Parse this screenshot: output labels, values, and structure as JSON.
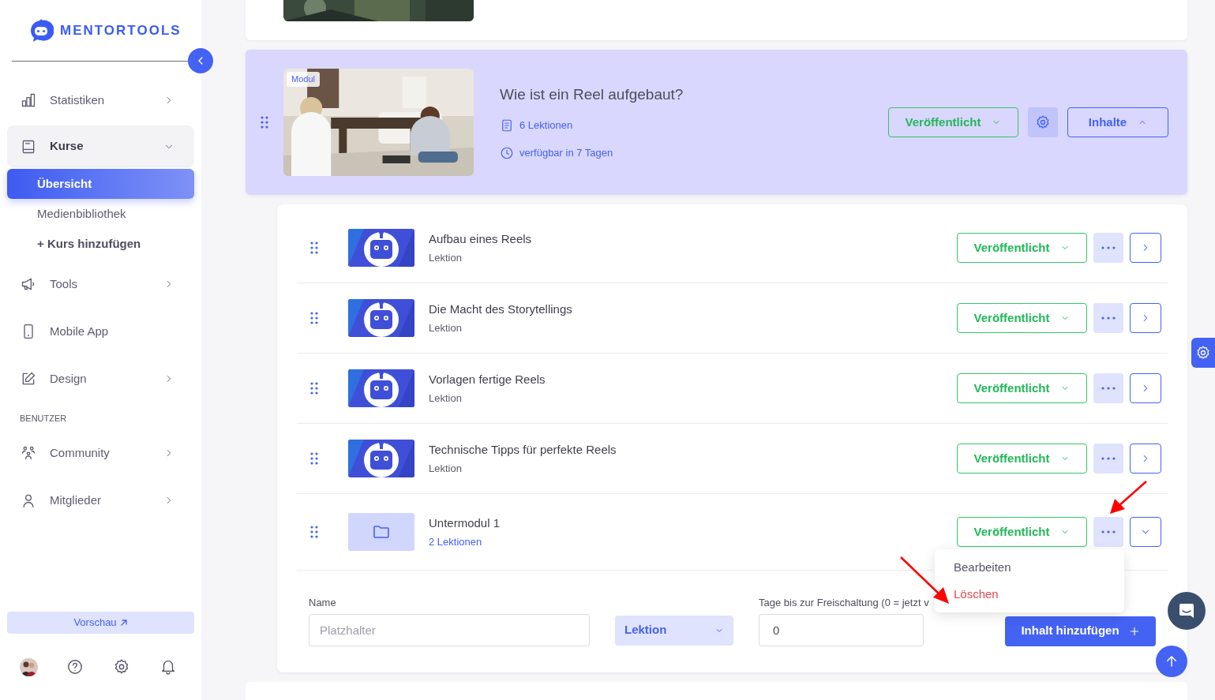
{
  "brand": "MENTORTOOLS",
  "sidebar": {
    "items": [
      {
        "kind": "item",
        "label": "Statistiken",
        "expanded": false
      },
      {
        "kind": "item",
        "label": "Kurse",
        "expanded": true,
        "children": [
          {
            "label": "Übersicht",
            "selected": true
          },
          {
            "label": "Medienbibliothek",
            "selected": false
          },
          {
            "label": "+ Kurs hinzufügen",
            "selected": false
          }
        ]
      },
      {
        "kind": "item",
        "label": "Tools",
        "expanded": false
      },
      {
        "kind": "item",
        "label": "Mobile App"
      },
      {
        "kind": "item",
        "label": "Design",
        "expanded": false
      },
      {
        "kind": "section",
        "label": "BENUTZER"
      },
      {
        "kind": "item",
        "label": "Community",
        "expanded": false
      },
      {
        "kind": "item",
        "label": "Mitglieder",
        "expanded": false
      }
    ],
    "preview_button": "Vorschau"
  },
  "module": {
    "badge": "Modul",
    "title": "Wie ist ein Reel aufgebaut?",
    "lessons": "6 Lektionen",
    "availability": "verfügbar in 7 Tagen",
    "status": "Veröffentlicht",
    "contents_button": "Inhalte",
    "expanded": true
  },
  "items": [
    {
      "kind": "lesson",
      "title": "Aufbau eines Reels",
      "subtitle": "Lektion",
      "status": "Veröffentlicht"
    },
    {
      "kind": "lesson",
      "title": "Die Macht des Storytellings",
      "subtitle": "Lektion",
      "status": "Veröffentlicht"
    },
    {
      "kind": "lesson",
      "title": "Vorlagen fertige Reels",
      "subtitle": "Lektion",
      "status": "Veröffentlicht"
    },
    {
      "kind": "lesson",
      "title": "Technische Tipps für perfekte Reels",
      "subtitle": "Lektion",
      "status": "Veröffentlicht"
    },
    {
      "kind": "submodule",
      "title": "Untermodul 1",
      "subtitle": "2 Lektionen",
      "status": "Veröffentlicht"
    }
  ],
  "context_menu": [
    {
      "kind": "normal",
      "label": "Bearbeiten"
    },
    {
      "kind": "danger",
      "label": "Löschen"
    }
  ],
  "form": {
    "name_label": "Name",
    "name_placeholder": "Platzhalter",
    "type_value": "Lektion",
    "days_label": "Tage bis zur Freischaltung (0 = jetzt v",
    "days_value": "0",
    "add_button": "Inhalt hinzufügen"
  }
}
